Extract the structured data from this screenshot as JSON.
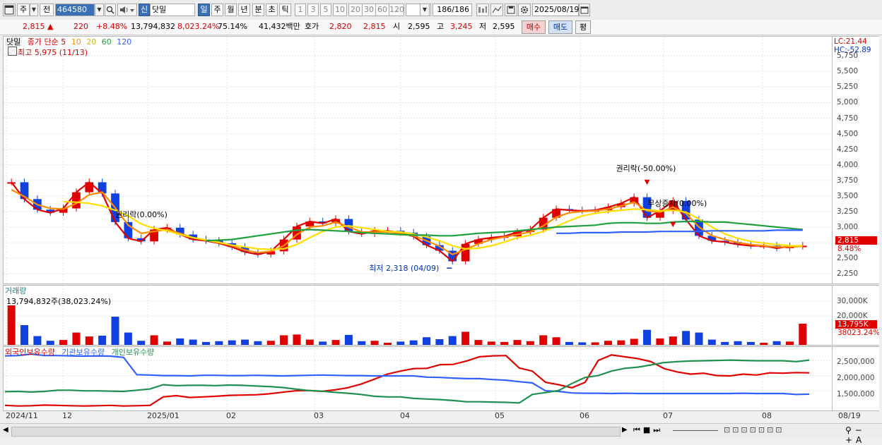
{
  "toolbar": {
    "market_label": "주",
    "prev_label": "전",
    "code": "464580",
    "new_label": "신",
    "name": "닷밀",
    "periods": [
      "일",
      "주",
      "월",
      "년",
      "분",
      "초",
      "틱"
    ],
    "selected_period": "일",
    "intervals": [
      "1",
      "3",
      "5",
      "10",
      "20",
      "30",
      "60",
      "120"
    ],
    "bar_count": "186/186",
    "date": "2025/08/19"
  },
  "quote": {
    "price": "2,815",
    "change": "220",
    "change_pct": "+8.48%",
    "volume": "13,794,832",
    "volume_ratio": "8,023.24%",
    "turnover_ratio": "75.14%",
    "amount": "41,432백만",
    "bid_label": "호가",
    "ask_price": "2,820",
    "bid_price": "2,815",
    "open_label": "시",
    "open": "2,595",
    "high_label": "고",
    "high": "3,245",
    "low_label": "저",
    "low": "2,595",
    "buy_label": "매수",
    "sell_label": "매도",
    "eval_label": "평"
  },
  "price_panel": {
    "name": "닷밀",
    "ma_label": "종가 단순",
    "ma_periods": [
      "5",
      "10",
      "20",
      "60",
      "120"
    ],
    "high_note": "최고 5,975 (11/13)",
    "low_note": "최저 2,318 (04/09)",
    "lc": "LC:21.44",
    "hc": "HC:-52.89",
    "price_tag": "2,815",
    "pct_tag": "8.48%",
    "y_ticks": [
      "5,750",
      "5,500",
      "5,250",
      "5,000",
      "4,750",
      "4,500",
      "4,250",
      "4,000",
      "3,750",
      "3,500",
      "3,250",
      "3,000",
      "2,750",
      "2,500",
      "2,250"
    ],
    "events": [
      {
        "label": "권리락(-50.00%)"
      },
      {
        "label": "권리락(0.00%)"
      },
      {
        "label": "무상증자(0.00%)"
      }
    ]
  },
  "volume_panel": {
    "title": "거래량",
    "value_note": "13,794,832주(38,023.24%)",
    "y_ticks": [
      "30,000K",
      "20,000K"
    ],
    "tag": "13,795K",
    "pct_tag": "38023.24%"
  },
  "holder_panel": {
    "legend": [
      "외국인보유수량",
      "기관보유수량",
      "개인보유수량"
    ],
    "y_ticks": [
      "2,500,000",
      "2,000,000",
      "1,500,000"
    ]
  },
  "x_ticks": [
    "2024/11",
    "12",
    "2025/01",
    "02",
    "03",
    "04",
    "05",
    "06",
    "07",
    "08"
  ],
  "x_current": "08/19",
  "chart_data": {
    "type": "candlestick",
    "ylim": [
      2150,
      5900
    ],
    "ma_series": [
      {
        "name": "5",
        "color": "#e00000",
        "values": [
          3720,
          3450,
          3280,
          3230,
          3300,
          3560,
          3720,
          3540,
          3080,
          2820,
          2770,
          2960,
          2990,
          2880,
          2800,
          2780,
          2740,
          2680,
          2600,
          2560,
          2610,
          2800,
          3010,
          3090,
          3060,
          3130,
          2930,
          2890,
          2940,
          2940,
          2910,
          2850,
          2710,
          2620,
          2450,
          2730,
          2800,
          2830,
          2850,
          2920,
          2960,
          3150,
          3290,
          3270,
          3260,
          3270,
          3320,
          3380,
          3480,
          3150,
          3260,
          3420,
          3120,
          2860,
          2780,
          2760,
          2720,
          2700,
          2700,
          2660,
          2690,
          2700
        ]
      },
      {
        "name": "10",
        "color": "#ff8c00",
        "values": [
          3600,
          3490,
          3360,
          3300,
          3290,
          3380,
          3520,
          3560,
          3310,
          3030,
          2900,
          2930,
          2960,
          2900,
          2830,
          2790,
          2760,
          2700,
          2630,
          2590,
          2610,
          2700,
          2880,
          3000,
          3020,
          3080,
          3000,
          2920,
          2920,
          2920,
          2900,
          2860,
          2780,
          2690,
          2560,
          2640,
          2730,
          2800,
          2840,
          2880,
          2920,
          3020,
          3160,
          3230,
          3250,
          3260,
          3290,
          3340,
          3400,
          3260,
          3240,
          3320,
          3220,
          3000,
          2860,
          2800,
          2750,
          2720,
          2700,
          2680,
          2680,
          2690
        ]
      },
      {
        "name": "20",
        "color": "#ffe000",
        "values": [
          null,
          null,
          null,
          null,
          3410,
          3400,
          3380,
          3340,
          3270,
          3180,
          3050,
          2980,
          2940,
          2880,
          2830,
          2790,
          2750,
          2710,
          2680,
          2650,
          2640,
          2650,
          2720,
          2830,
          2930,
          3000,
          3020,
          2990,
          2960,
          2930,
          2920,
          2890,
          2840,
          2780,
          2700,
          2650,
          2660,
          2700,
          2760,
          2830,
          2870,
          2930,
          3010,
          3100,
          3180,
          3220,
          3250,
          3270,
          3290,
          3280,
          3260,
          3270,
          3240,
          3130,
          3000,
          2890,
          2820,
          2770,
          2740,
          2720,
          2700,
          2700
        ]
      },
      {
        "name": "60",
        "color": "#20a040",
        "values": [
          null,
          null,
          null,
          null,
          null,
          null,
          null,
          null,
          null,
          null,
          null,
          null,
          null,
          null,
          null,
          2780,
          2790,
          2800,
          2830,
          2860,
          2890,
          2920,
          2950,
          2960,
          2950,
          2940,
          2930,
          2910,
          2900,
          2890,
          2880,
          2870,
          2870,
          2860,
          2860,
          2880,
          2900,
          2910,
          2920,
          2940,
          2960,
          2980,
          3000,
          3010,
          3020,
          3030,
          3060,
          3070,
          3070,
          3060,
          3060,
          3080,
          3090,
          3090,
          3080,
          3080,
          3060,
          3040,
          3020,
          3000,
          2980,
          2960
        ]
      },
      {
        "name": "120",
        "color": "#3060ff",
        "values": [
          null,
          null,
          null,
          null,
          null,
          null,
          null,
          null,
          null,
          null,
          null,
          null,
          null,
          null,
          null,
          null,
          null,
          null,
          null,
          null,
          null,
          null,
          null,
          null,
          null,
          null,
          null,
          null,
          null,
          null,
          null,
          null,
          null,
          null,
          null,
          null,
          null,
          null,
          null,
          null,
          null,
          null,
          2900,
          2900,
          2910,
          2910,
          2910,
          2920,
          2920,
          2920,
          2930,
          2930,
          2930,
          2930,
          2940,
          2940,
          2940,
          2940,
          2940,
          2950,
          2950,
          2950
        ]
      }
    ],
    "holder_series": [
      {
        "name": "외국인보유수량",
        "color": "#e00000",
        "values": [
          1020000,
          1000000,
          1010000,
          1030000,
          1020000,
          1010000,
          1000000,
          1010000,
          1020000,
          1000000,
          1010000,
          1020000,
          1300000,
          1340000,
          1280000,
          1300000,
          1320000,
          1350000,
          1360000,
          1370000,
          1400000,
          1450000,
          1500000,
          1510000,
          1480000,
          1530000,
          1600000,
          1720000,
          1880000,
          2050000,
          2150000,
          2230000,
          2240000,
          2360000,
          2370000,
          2480000,
          2620000,
          2650000,
          2660000,
          2250000,
          2150000,
          1780000,
          1700000,
          1600000,
          1780000,
          2500000,
          2680000,
          2620000,
          2560000,
          2460000,
          2230000,
          2120000,
          2050000,
          2080000,
          2000000,
          1990000,
          2050000,
          2020000,
          2090000,
          2080000,
          2100000,
          2090000
        ]
      },
      {
        "name": "기관보유수량",
        "color": "#3060ff",
        "values": [
          2650000,
          2660000,
          2710000,
          2660000,
          2660000,
          2650000,
          2640000,
          2650000,
          2640000,
          2600000,
          2030000,
          2020000,
          2000000,
          2000000,
          1990000,
          2010000,
          2010000,
          2000000,
          2000000,
          2010000,
          2000000,
          1990000,
          2000000,
          2010000,
          2020000,
          2010000,
          2000000,
          2000000,
          1990000,
          1990000,
          1990000,
          1990000,
          1950000,
          1940000,
          1920000,
          1900000,
          1900000,
          1870000,
          1850000,
          1800000,
          1760000,
          1500000,
          1480000,
          1430000,
          1420000,
          1420000,
          1410000,
          1420000,
          1410000,
          1410000,
          1410000,
          1410000,
          1410000,
          1410000,
          1410000,
          1410000,
          1420000,
          1410000,
          1410000,
          1410000,
          1380000,
          1390000
        ]
      },
      {
        "name": "개인보유수량",
        "color": "#209050",
        "values": [
          1470000,
          1480000,
          1460000,
          1480000,
          1520000,
          1520000,
          1500000,
          1500000,
          1490000,
          1480000,
          1520000,
          1560000,
          1700000,
          1670000,
          1680000,
          1680000,
          1670000,
          1690000,
          1680000,
          1660000,
          1640000,
          1610000,
          1560000,
          1510000,
          1490000,
          1450000,
          1420000,
          1380000,
          1320000,
          1300000,
          1300000,
          1250000,
          1230000,
          1210000,
          1180000,
          1140000,
          1140000,
          1130000,
          1120000,
          1100000,
          1380000,
          1440000,
          1510000,
          1740000,
          1940000,
          2000000,
          2150000,
          2240000,
          2280000,
          2350000,
          2430000,
          2460000,
          2480000,
          2490000,
          2500000,
          2510000,
          2500000,
          2490000,
          2490000,
          2490000,
          2460000,
          2510000
        ]
      }
    ]
  },
  "icons": [
    "window-icon",
    "search-icon",
    "speaker-icon",
    "calendar-icon",
    "settings-icon",
    "save-icon",
    "chart-type-icon"
  ]
}
